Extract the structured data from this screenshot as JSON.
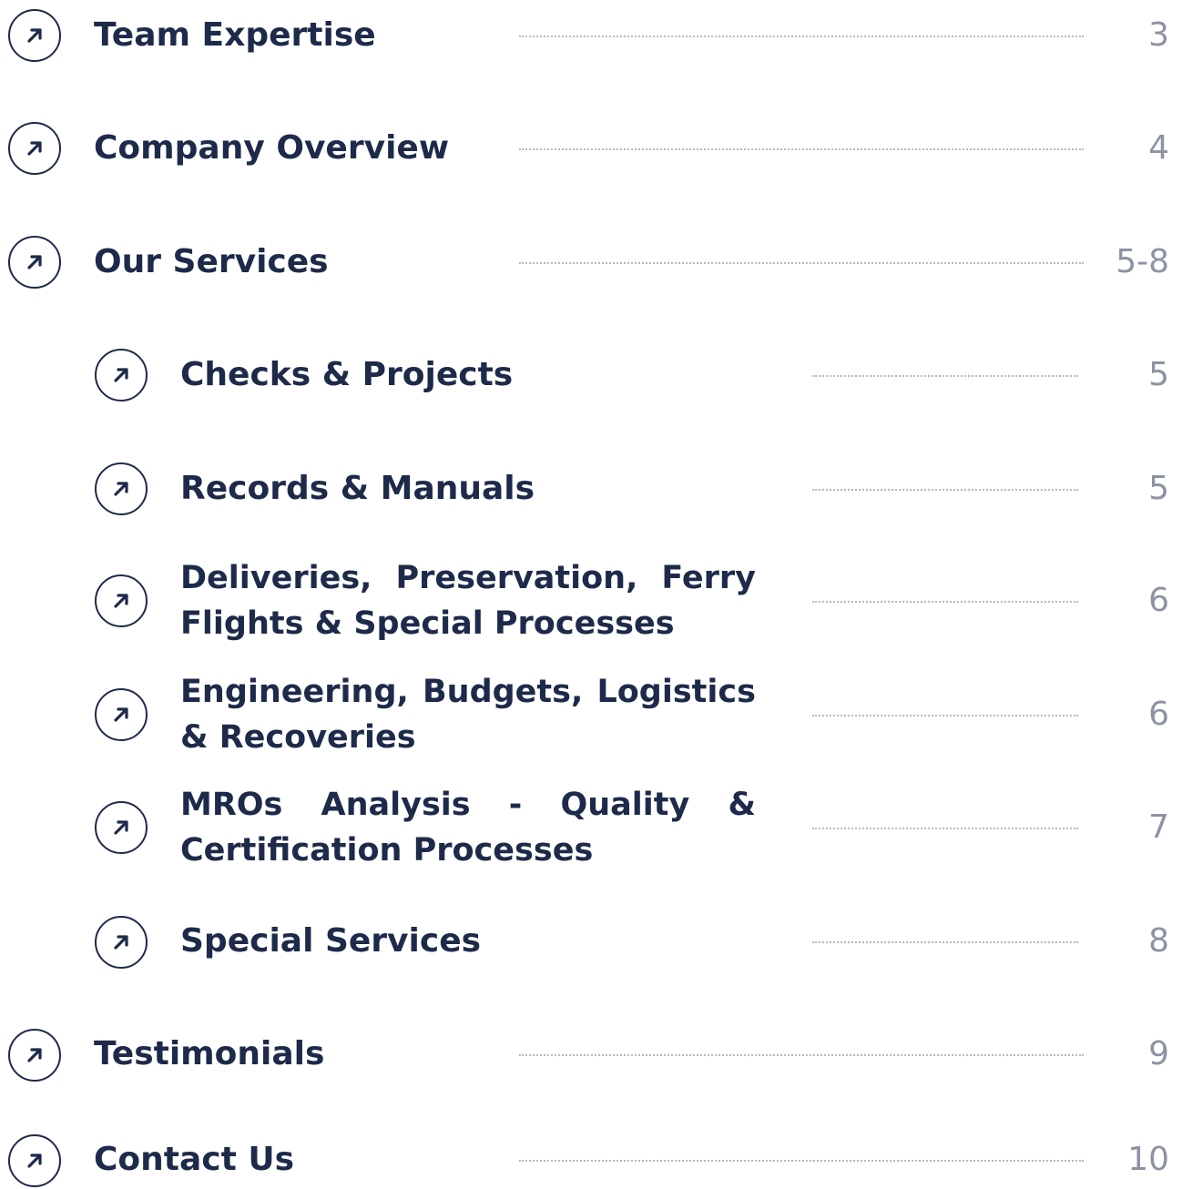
{
  "colors": {
    "text": "#1e2a4a",
    "page_number": "#8d93a3",
    "leader_dots": "#b4b9c6"
  },
  "icon": "arrow-up-right-icon",
  "toc": {
    "items": [
      {
        "label": "Team Expertise",
        "page": "3",
        "level": 1
      },
      {
        "label": "Company Overview",
        "page": "4",
        "level": 1
      },
      {
        "label": "Our Services",
        "page": "5-8",
        "level": 1
      },
      {
        "label": "Checks & Projects",
        "page": "5",
        "level": 2
      },
      {
        "label": "Records & Manuals",
        "page": "5",
        "level": 2
      },
      {
        "label": "Deliveries, Preservation, Ferry Flights & Special Processes",
        "page": "6",
        "level": 2
      },
      {
        "label": "Engineering, Budgets, Logistics & Recoveries",
        "page": "6",
        "level": 2
      },
      {
        "label": "MROs Analysis - Quality & Certification Processes",
        "page": "7",
        "level": 2
      },
      {
        "label": "Special Services",
        "page": "8",
        "level": 2
      },
      {
        "label": "Testimonials",
        "page": "9",
        "level": 1
      },
      {
        "label": "Contact Us",
        "page": "10",
        "level": 1
      }
    ]
  }
}
